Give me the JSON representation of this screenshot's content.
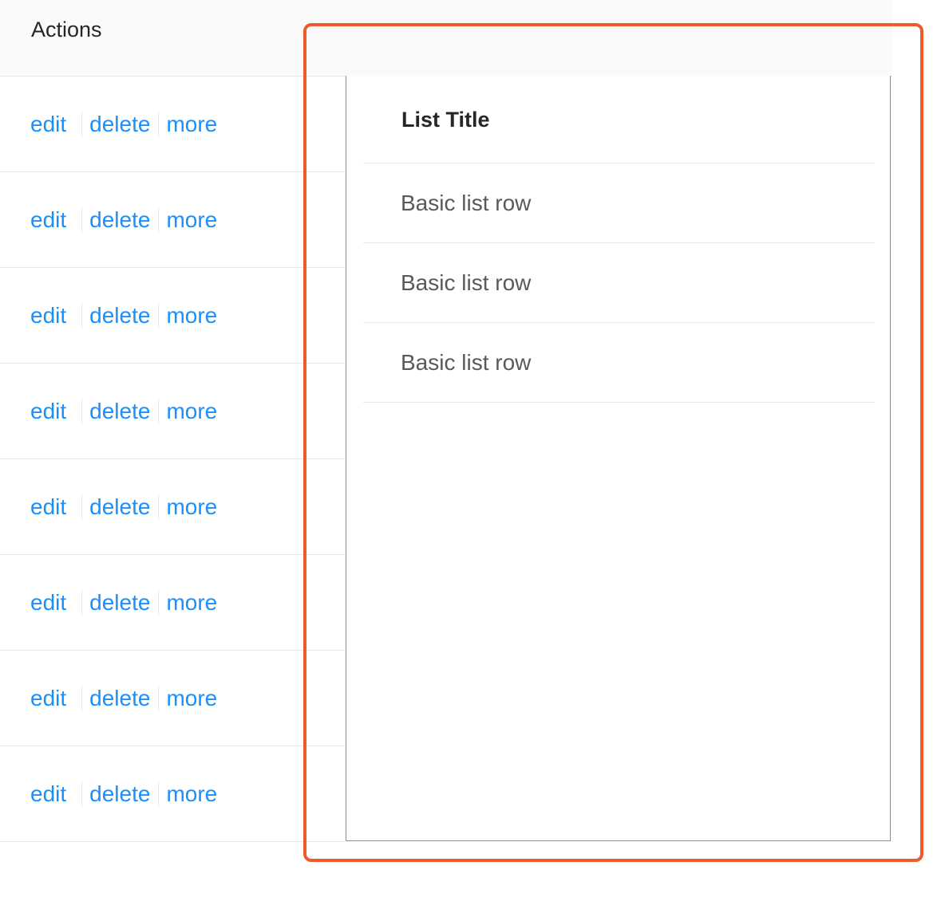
{
  "table": {
    "header": {
      "actions_label": "Actions"
    },
    "rows": [
      {
        "edit": "edit",
        "delete": "delete",
        "more": "more"
      },
      {
        "edit": "edit",
        "delete": "delete",
        "more": "more"
      },
      {
        "edit": "edit",
        "delete": "delete",
        "more": "more"
      },
      {
        "edit": "edit",
        "delete": "delete",
        "more": "more"
      },
      {
        "edit": "edit",
        "delete": "delete",
        "more": "more"
      },
      {
        "edit": "edit",
        "delete": "delete",
        "more": "more"
      },
      {
        "edit": "edit",
        "delete": "delete",
        "more": "more"
      },
      {
        "edit": "edit",
        "delete": "delete",
        "more": "more"
      }
    ]
  },
  "dropdown_panel": {
    "title": "List Title",
    "items": [
      {
        "label": "Basic list row"
      },
      {
        "label": "Basic list row"
      },
      {
        "label": "Basic list row"
      }
    ]
  },
  "colors": {
    "link": "#1890ff",
    "highlight_border": "#ee5a2e",
    "header_bg": "#fafafa"
  }
}
